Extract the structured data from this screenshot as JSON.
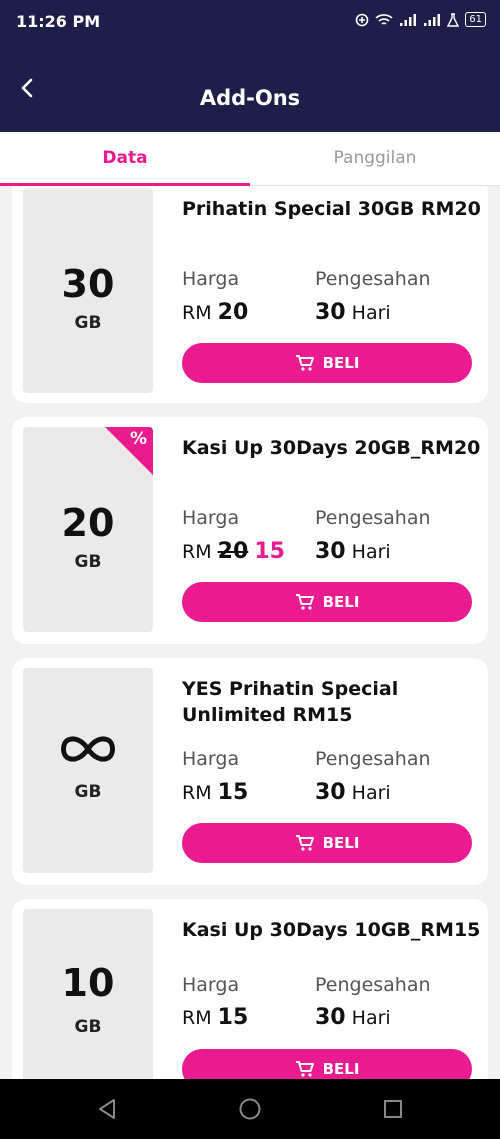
{
  "status_bar": {
    "time": "11:26 PM",
    "battery": "61"
  },
  "header": {
    "title": "Add-Ons"
  },
  "tabs": [
    {
      "label": "Data",
      "active": true
    },
    {
      "label": "Panggilan",
      "active": false
    }
  ],
  "accent_color": "#ea1a8f",
  "header_color": "#1e1e4a",
  "cards": [
    {
      "size": "30",
      "unit": "GB",
      "title": "Prihatin Special 30GB RM20",
      "harga_label": "Harga",
      "currency": "RM",
      "price": "20",
      "old_price": "",
      "validity_label": "Pengesahan",
      "validity_value": "30",
      "validity_unit": "Hari",
      "button_label": "BELI"
    },
    {
      "size": "20",
      "unit": "GB",
      "title": "Kasi Up 30Days 20GB_RM20",
      "harga_label": "Harga",
      "currency": "RM",
      "price": "15",
      "old_price": "20",
      "promo_badge": "%",
      "validity_label": "Pengesahan",
      "validity_value": "30",
      "validity_unit": "Hari",
      "button_label": "BELI"
    },
    {
      "size": "∞",
      "unit": "GB",
      "title": "YES Prihatin Special Unlimited RM15",
      "harga_label": "Harga",
      "currency": "RM",
      "price": "15",
      "old_price": "",
      "validity_label": "Pengesahan",
      "validity_value": "30",
      "validity_unit": "Hari",
      "button_label": "BELI"
    },
    {
      "size": "10",
      "unit": "GB",
      "title": "Kasi Up 30Days 10GB_RM15",
      "harga_label": "Harga",
      "currency": "RM",
      "price": "15",
      "old_price": "",
      "validity_label": "Pengesahan",
      "validity_value": "30",
      "validity_unit": "Hari",
      "button_label": "BELI"
    }
  ]
}
